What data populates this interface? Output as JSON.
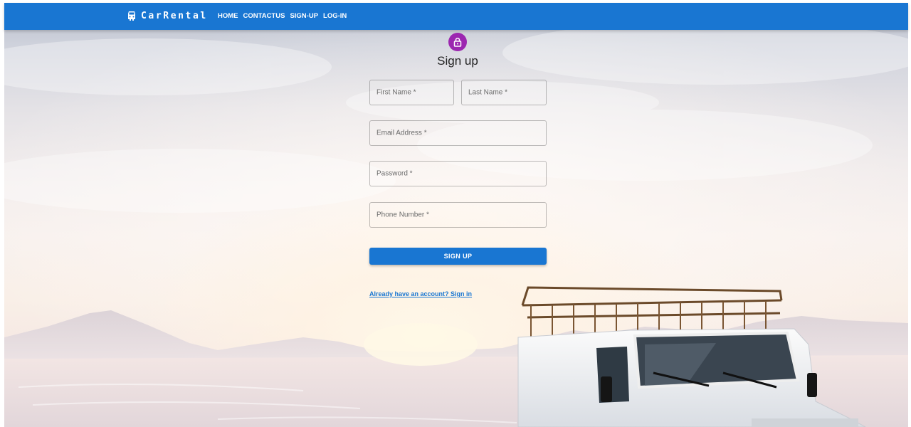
{
  "navbar": {
    "brand": "CarRental",
    "brand_icon": "car-icon",
    "color": "#1976d2",
    "links": [
      {
        "label": "HOME"
      },
      {
        "label": "CONTACTUS"
      },
      {
        "label": "SIGN-UP"
      },
      {
        "label": "LOG-IN"
      }
    ]
  },
  "form": {
    "avatar_icon": "lock-icon",
    "avatar_color": "#9c27b0",
    "title": "Sign up",
    "fields": {
      "first_name": {
        "placeholder": "First Name *",
        "value": ""
      },
      "last_name": {
        "placeholder": "Last Name *",
        "value": ""
      },
      "email": {
        "placeholder": "Email Address *",
        "value": ""
      },
      "password": {
        "placeholder": "Password *",
        "value": ""
      },
      "phone": {
        "placeholder": "Phone Number *",
        "value": ""
      }
    },
    "submit_label": "SIGN UP",
    "signin_link": "Already have an account? Sign in"
  },
  "background": {
    "scene": "snowy-mountains-sunrise-with-white-offroad-vehicle"
  }
}
